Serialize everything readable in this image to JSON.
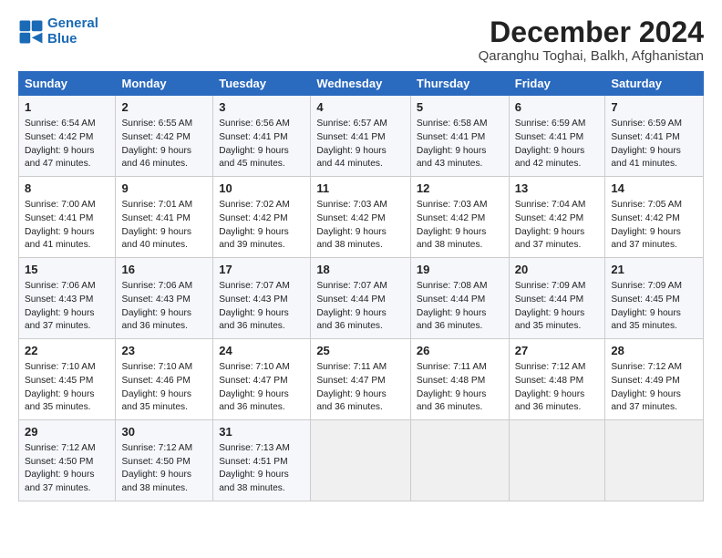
{
  "logo": {
    "line1": "General",
    "line2": "Blue"
  },
  "title": "December 2024",
  "subtitle": "Qaranghu Toghai, Balkh, Afghanistan",
  "days_of_week": [
    "Sunday",
    "Monday",
    "Tuesday",
    "Wednesday",
    "Thursday",
    "Friday",
    "Saturday"
  ],
  "weeks": [
    [
      {
        "day": 1,
        "lines": [
          "Sunrise: 6:54 AM",
          "Sunset: 4:42 PM",
          "Daylight: 9 hours",
          "and 47 minutes."
        ]
      },
      {
        "day": 2,
        "lines": [
          "Sunrise: 6:55 AM",
          "Sunset: 4:42 PM",
          "Daylight: 9 hours",
          "and 46 minutes."
        ]
      },
      {
        "day": 3,
        "lines": [
          "Sunrise: 6:56 AM",
          "Sunset: 4:41 PM",
          "Daylight: 9 hours",
          "and 45 minutes."
        ]
      },
      {
        "day": 4,
        "lines": [
          "Sunrise: 6:57 AM",
          "Sunset: 4:41 PM",
          "Daylight: 9 hours",
          "and 44 minutes."
        ]
      },
      {
        "day": 5,
        "lines": [
          "Sunrise: 6:58 AM",
          "Sunset: 4:41 PM",
          "Daylight: 9 hours",
          "and 43 minutes."
        ]
      },
      {
        "day": 6,
        "lines": [
          "Sunrise: 6:59 AM",
          "Sunset: 4:41 PM",
          "Daylight: 9 hours",
          "and 42 minutes."
        ]
      },
      {
        "day": 7,
        "lines": [
          "Sunrise: 6:59 AM",
          "Sunset: 4:41 PM",
          "Daylight: 9 hours",
          "and 41 minutes."
        ]
      }
    ],
    [
      {
        "day": 8,
        "lines": [
          "Sunrise: 7:00 AM",
          "Sunset: 4:41 PM",
          "Daylight: 9 hours",
          "and 41 minutes."
        ]
      },
      {
        "day": 9,
        "lines": [
          "Sunrise: 7:01 AM",
          "Sunset: 4:41 PM",
          "Daylight: 9 hours",
          "and 40 minutes."
        ]
      },
      {
        "day": 10,
        "lines": [
          "Sunrise: 7:02 AM",
          "Sunset: 4:42 PM",
          "Daylight: 9 hours",
          "and 39 minutes."
        ]
      },
      {
        "day": 11,
        "lines": [
          "Sunrise: 7:03 AM",
          "Sunset: 4:42 PM",
          "Daylight: 9 hours",
          "and 38 minutes."
        ]
      },
      {
        "day": 12,
        "lines": [
          "Sunrise: 7:03 AM",
          "Sunset: 4:42 PM",
          "Daylight: 9 hours",
          "and 38 minutes."
        ]
      },
      {
        "day": 13,
        "lines": [
          "Sunrise: 7:04 AM",
          "Sunset: 4:42 PM",
          "Daylight: 9 hours",
          "and 37 minutes."
        ]
      },
      {
        "day": 14,
        "lines": [
          "Sunrise: 7:05 AM",
          "Sunset: 4:42 PM",
          "Daylight: 9 hours",
          "and 37 minutes."
        ]
      }
    ],
    [
      {
        "day": 15,
        "lines": [
          "Sunrise: 7:06 AM",
          "Sunset: 4:43 PM",
          "Daylight: 9 hours",
          "and 37 minutes."
        ]
      },
      {
        "day": 16,
        "lines": [
          "Sunrise: 7:06 AM",
          "Sunset: 4:43 PM",
          "Daylight: 9 hours",
          "and 36 minutes."
        ]
      },
      {
        "day": 17,
        "lines": [
          "Sunrise: 7:07 AM",
          "Sunset: 4:43 PM",
          "Daylight: 9 hours",
          "and 36 minutes."
        ]
      },
      {
        "day": 18,
        "lines": [
          "Sunrise: 7:07 AM",
          "Sunset: 4:44 PM",
          "Daylight: 9 hours",
          "and 36 minutes."
        ]
      },
      {
        "day": 19,
        "lines": [
          "Sunrise: 7:08 AM",
          "Sunset: 4:44 PM",
          "Daylight: 9 hours",
          "and 36 minutes."
        ]
      },
      {
        "day": 20,
        "lines": [
          "Sunrise: 7:09 AM",
          "Sunset: 4:44 PM",
          "Daylight: 9 hours",
          "and 35 minutes."
        ]
      },
      {
        "day": 21,
        "lines": [
          "Sunrise: 7:09 AM",
          "Sunset: 4:45 PM",
          "Daylight: 9 hours",
          "and 35 minutes."
        ]
      }
    ],
    [
      {
        "day": 22,
        "lines": [
          "Sunrise: 7:10 AM",
          "Sunset: 4:45 PM",
          "Daylight: 9 hours",
          "and 35 minutes."
        ]
      },
      {
        "day": 23,
        "lines": [
          "Sunrise: 7:10 AM",
          "Sunset: 4:46 PM",
          "Daylight: 9 hours",
          "and 35 minutes."
        ]
      },
      {
        "day": 24,
        "lines": [
          "Sunrise: 7:10 AM",
          "Sunset: 4:47 PM",
          "Daylight: 9 hours",
          "and 36 minutes."
        ]
      },
      {
        "day": 25,
        "lines": [
          "Sunrise: 7:11 AM",
          "Sunset: 4:47 PM",
          "Daylight: 9 hours",
          "and 36 minutes."
        ]
      },
      {
        "day": 26,
        "lines": [
          "Sunrise: 7:11 AM",
          "Sunset: 4:48 PM",
          "Daylight: 9 hours",
          "and 36 minutes."
        ]
      },
      {
        "day": 27,
        "lines": [
          "Sunrise: 7:12 AM",
          "Sunset: 4:48 PM",
          "Daylight: 9 hours",
          "and 36 minutes."
        ]
      },
      {
        "day": 28,
        "lines": [
          "Sunrise: 7:12 AM",
          "Sunset: 4:49 PM",
          "Daylight: 9 hours",
          "and 37 minutes."
        ]
      }
    ],
    [
      {
        "day": 29,
        "lines": [
          "Sunrise: 7:12 AM",
          "Sunset: 4:50 PM",
          "Daylight: 9 hours",
          "and 37 minutes."
        ]
      },
      {
        "day": 30,
        "lines": [
          "Sunrise: 7:12 AM",
          "Sunset: 4:50 PM",
          "Daylight: 9 hours",
          "and 38 minutes."
        ]
      },
      {
        "day": 31,
        "lines": [
          "Sunrise: 7:13 AM",
          "Sunset: 4:51 PM",
          "Daylight: 9 hours",
          "and 38 minutes."
        ]
      },
      null,
      null,
      null,
      null
    ]
  ]
}
